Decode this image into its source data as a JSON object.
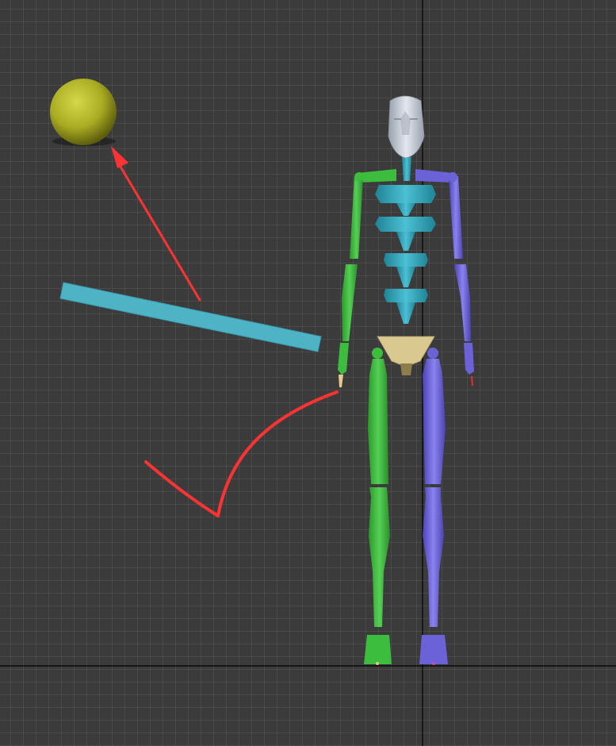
{
  "viewport": {
    "view": "front",
    "grid": true,
    "colors": {
      "background": "#3b3b3b",
      "grid_line": "#4a4a4a",
      "world_axis": "#000000"
    }
  },
  "scene": {
    "objects": [
      {
        "name": "sphere",
        "color": "#b3b52a"
      },
      {
        "name": "box",
        "color": "#4fb3c6"
      },
      {
        "name": "biped-skeleton",
        "colors": {
          "head": "#c9ced8",
          "spine": "#2f9db3",
          "pelvis": "#d9c88f",
          "left-side": "#3dbd3d",
          "right-side": "#6a62d6"
        }
      }
    ]
  },
  "annotations": [
    {
      "type": "arrow",
      "color": "#ff3333",
      "points_to": "sphere"
    },
    {
      "type": "checkmark",
      "color": "#ff3333"
    }
  ]
}
